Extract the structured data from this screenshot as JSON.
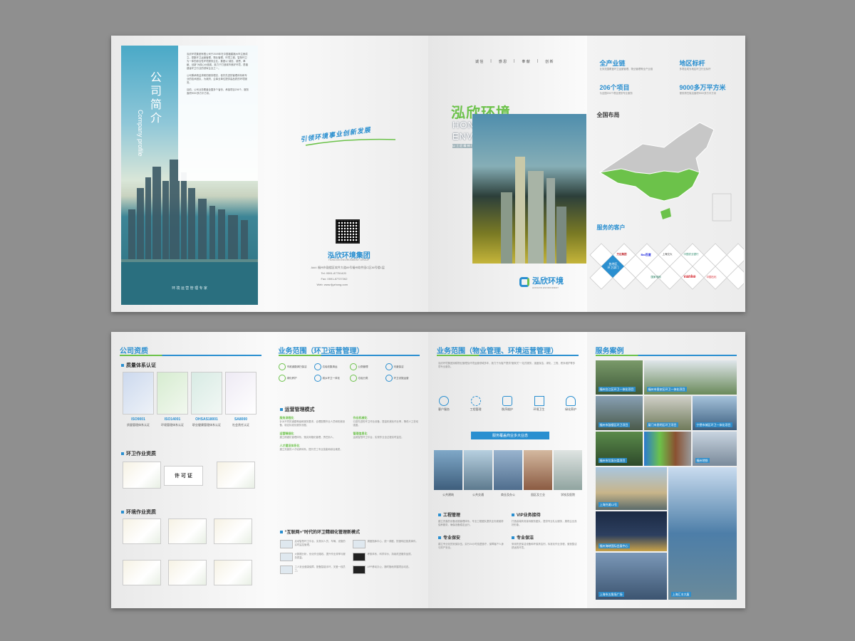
{
  "cover": {
    "title_cn": "公司简介",
    "title_en": "Company profile",
    "footer": "环 境 运 营 管 理 专 家"
  },
  "back": {
    "slogan": "引领环境事业创新发展",
    "brand": "泓欣环境集团",
    "brand_en": "HONGXIN ENVIRONMENT GROUP",
    "addr_label": "Add:",
    "addr": "福州市鼓楼区软件大道89号福州软件园C区36号楼1层",
    "tel_label": "Tel:",
    "tel": "0591-87761420",
    "fax_label": "Fax:",
    "fax": "0591-87727262",
    "web_label": "Web:",
    "web": "www.fjyzhong.com"
  },
  "front": {
    "nav": [
      "诚 信",
      "感 恩",
      "奉 献",
      "创 新"
    ],
    "title_cn": "泓欣环境",
    "title_en1": "HONGXIN",
    "title_en2": "ENVIRONMENT",
    "tagline": "以 工 匠 精 神 打 造 城 市 美 好 环 境 运 营 企 业",
    "logo": "泓欣环境",
    "logo_en": "HONGXIN ENVIRONMENT"
  },
  "layout": {
    "stats": [
      {
        "label": "全产业链",
        "desc": "业务范围覆盖环卫运营管理、物业管理等全产业链"
      },
      {
        "label": "地区标杆",
        "desc": "多项目成为地区环卫行业标杆"
      },
      {
        "label": "206个项目",
        "desc": "为全国206个项目提供专业服务"
      },
      {
        "label": "9000多万平方米",
        "desc": "服务清扫保洁面积9000多万平方米"
      }
    ],
    "national": "全国布局",
    "clients": "服务的客户",
    "client_names": [
      "万达集团",
      "Bai百度",
      "上海交大",
      "中国农业银行",
      "各地区环卫部门",
      "国家电网",
      "vanke万科",
      "中国石化",
      "碧桂园"
    ],
    "gov_label": "各地区\n环卫部门",
    "vanke": "vanke"
  },
  "quals": {
    "title": "公司资质",
    "sec1": "质量体系认证",
    "certs1": [
      {
        "code": "ISO9001",
        "name": "质量管理体系认证"
      },
      {
        "code": "ISO14001",
        "name": "环境管理体系认证"
      },
      {
        "code": "OHSAS18001",
        "name": "职业健康管理体系认证"
      },
      {
        "code": "SA8000",
        "name": "社会责任认证"
      }
    ],
    "sec2": "环卫作业资质",
    "permit": "许 可 证",
    "certs2": [
      "城市生活垃圾经营性清扫、收集、运输服务许可证",
      "福建省环卫协会会员单位",
      "福建省环卫协会理事单位"
    ],
    "sec3": "环境作业资质",
    "certs3": [
      "福州市环卫协会会员单位",
      "福建省清洁行业协会会员",
      "福建省诚信企业",
      "信用评级证书",
      "有害生物防制服务资质证书",
      "AAA级信用企业证书"
    ]
  },
  "sanitation": {
    "title": "业务范围（环卫运营管理）",
    "icons": [
      "市政道路清扫保洁",
      "垃圾收集清运",
      "公厕管理",
      "河道保洁",
      "绿化养护",
      "城乡环卫一体化",
      "垃圾分类",
      "环卫设施运营"
    ],
    "mode_title": "运营管理模式",
    "modes": [
      {
        "h": "服务流程化",
        "t": "针对不同的道路等级和服务要求，合理配置作业人员和机械设备，制定标准化服务流程。"
      },
      {
        "h": "作业机械化",
        "t": "引进先进的环卫作业设备，提高机械化作业率，降低人工劳动强度。"
      },
      {
        "h": "运营精细化",
        "t": "建立精细化管理体系，落实网格化管理，责任到人。"
      },
      {
        "h": "管理信息化",
        "t": "运用智慧环卫平台，实现作业全过程实时监控。"
      },
      {
        "h": "人才建设体系化",
        "t": "建立完善的人才培养体系，提升员工专业技能和综合素质。"
      }
    ],
    "internet_title": "“互联网+”时代的环卫精细化管理新模式",
    "items": [
      "启动智慧环卫平台，实现对人员、车辆、设施的实时监控管理。",
      "大数据分析，优化作业路线，提升作业效率与服务质量。",
      "工人安全健康保障，配备智能手环，关爱一线员工。",
      "调度指挥中心，统一调度，快速响应各类事件。",
      "考核体系，科学评价，持续改进服务品质。",
      "APP移动办公，随时随地掌握项目动态。"
    ]
  },
  "property": {
    "title": "业务范围（物业管理、环境运营管理）",
    "intro": "泓欣环境集团深耕物业管理及环境运营领域多年，致力于为客户提供“管家式”一站式服务，涵盖保洁、绿化、工程、秩序维护等多项专业服务。",
    "icons": [
      "客户服务",
      "工程管理",
      "秩序维护",
      "环境卫生",
      "绿化养护"
    ],
    "banner": "服务覆盖商业多大业态",
    "photos": [
      "公共建筑",
      "公共交通",
      "商业及办公",
      "园区及工业",
      "学校及医院"
    ],
    "sections": [
      {
        "h": "工程管理",
        "t": "建立完善的设备设施管理体系，专业工程团队提供全天候维修保养服务，确保设备稳定运行。"
      },
      {
        "h": "VIP业务接待",
        "t": "打造高端商务接待服务团队，提供专业礼仪服务，展现企业良好形象。"
      },
      {
        "h": "专业保安",
        "t": "建立专业化的安保队伍，实行24小时巡逻值守，保障客户人身与财产安全。"
      },
      {
        "h": "专业保洁",
        "t": "采用先进保洁设备和环保清洁剂，标准化作业流程，营造整洁舒适的环境。"
      }
    ]
  },
  "cases": {
    "title": "服务案例",
    "items": [
      "福州台江区环卫一体化项目",
      "福州市晋安区环卫一体化项目",
      "福州市鼓楼区环卫项目",
      "厦门市思明区环卫项目",
      "宁德市城区环卫一体化项目",
      "福州市垃圾分类项目",
      "福州地铁",
      "上海外滩12号",
      "",
      "福州海峡国际会展中心",
      "上海市五角场广场",
      "上海汇丰大厦"
    ]
  },
  "colors": {
    "blue": "#2a8fd0",
    "green": "#6cc24a"
  }
}
